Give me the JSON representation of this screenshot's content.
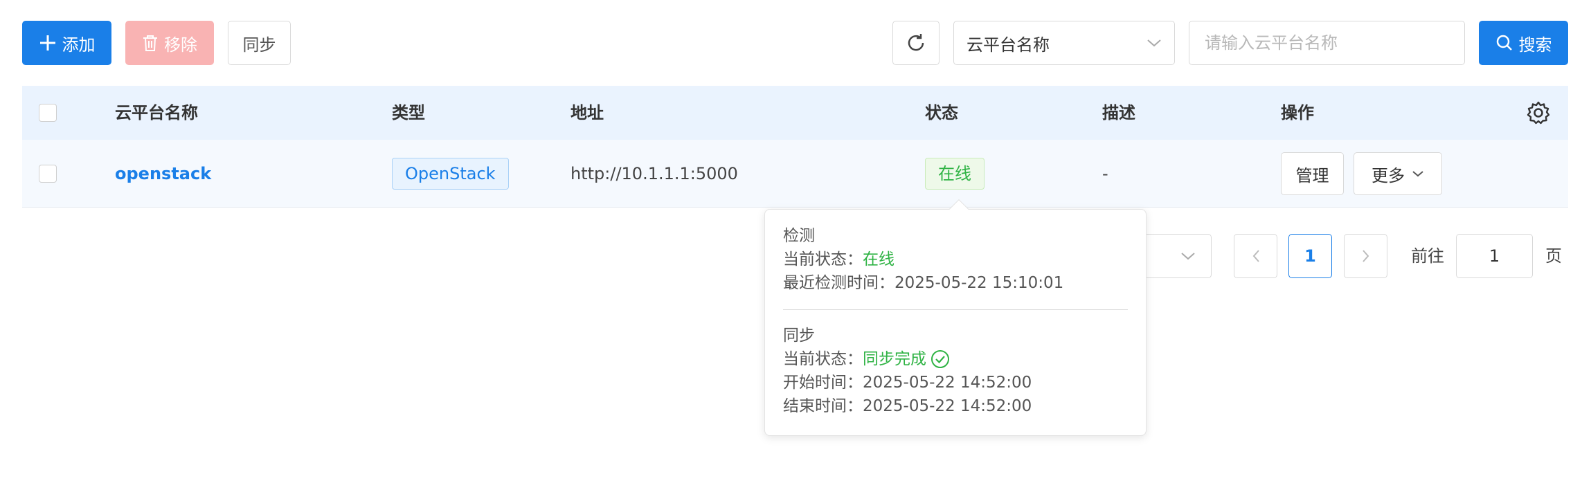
{
  "toolbar": {
    "add_label": "添加",
    "remove_label": "移除",
    "sync_label": "同步",
    "filter_select_value": "云平台名称",
    "search_placeholder": "请输入云平台名称",
    "search_label": "搜索"
  },
  "table": {
    "columns": [
      "云平台名称",
      "类型",
      "地址",
      "状态",
      "描述",
      "操作"
    ],
    "rows": [
      {
        "name": "openstack",
        "type": "OpenStack",
        "address": "http://10.1.1.1:5000",
        "status": "在线",
        "description": "-",
        "actions": {
          "manage": "管理",
          "more": "更多"
        }
      }
    ]
  },
  "pagination": {
    "current_page": "1",
    "goto_label": "前往",
    "goto_value": "1",
    "page_suffix": "页"
  },
  "popover": {
    "check_title": "检测",
    "check_status_label": "当前状态：",
    "check_status_value": "在线",
    "check_time_label": "最近检测时间：",
    "check_time_value": "2025-05-22 15:10:01",
    "sync_title": "同步",
    "sync_status_label": "当前状态：",
    "sync_status_value": "同步完成",
    "sync_start_label": "开始时间：",
    "sync_start_value": "2025-05-22 14:52:00",
    "sync_end_label": "结束时间：",
    "sync_end_value": "2025-05-22 14:52:00"
  },
  "colors": {
    "primary": "#1a7fe8",
    "danger_disabled": "#f9b3b3",
    "success": "#2fb344",
    "table_header_bg": "#eaf3fe"
  }
}
